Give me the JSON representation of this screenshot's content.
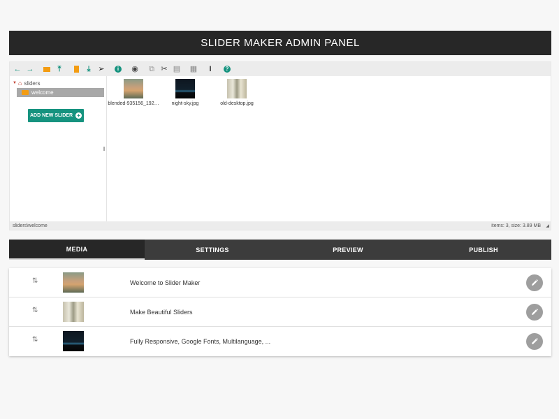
{
  "header": {
    "title": "SLIDER MAKER ADMIN PANEL"
  },
  "toolbar": {
    "icons": [
      "back-icon",
      "forward-icon",
      "new-folder-icon",
      "upload-icon",
      "new-file-icon",
      "download-icon",
      "pointer-icon",
      "info-icon",
      "view-icon",
      "copy-icon",
      "cut-icon",
      "paste-icon",
      "delete-icon",
      "rename-icon",
      "help-icon"
    ]
  },
  "tree": {
    "root": "sliders",
    "selected": "welcome",
    "add_button": "ADD NEW SLIDER"
  },
  "files": [
    {
      "name": "blended-935156_192…"
    },
    {
      "name": "night-sky.jpg"
    },
    {
      "name": "old-desktop.jpg"
    }
  ],
  "status": {
    "path": "sliders\\welcome",
    "info": "items: 3, size: 3.89 MB"
  },
  "tabs": [
    {
      "label": "MEDIA"
    },
    {
      "label": "SETTINGS"
    },
    {
      "label": "PREVIEW"
    },
    {
      "label": "PUBLISH"
    }
  ],
  "slides": [
    {
      "title": "Welcome to Slider Maker"
    },
    {
      "title": "Make Beautiful Sliders"
    },
    {
      "title": "Fully Responsive, Google Fonts, Multilanguage, ..."
    }
  ],
  "colors": {
    "header": "#272727",
    "accent": "#16937f",
    "folder": "#f39c12",
    "tab_bar": "#3c3c3c"
  }
}
